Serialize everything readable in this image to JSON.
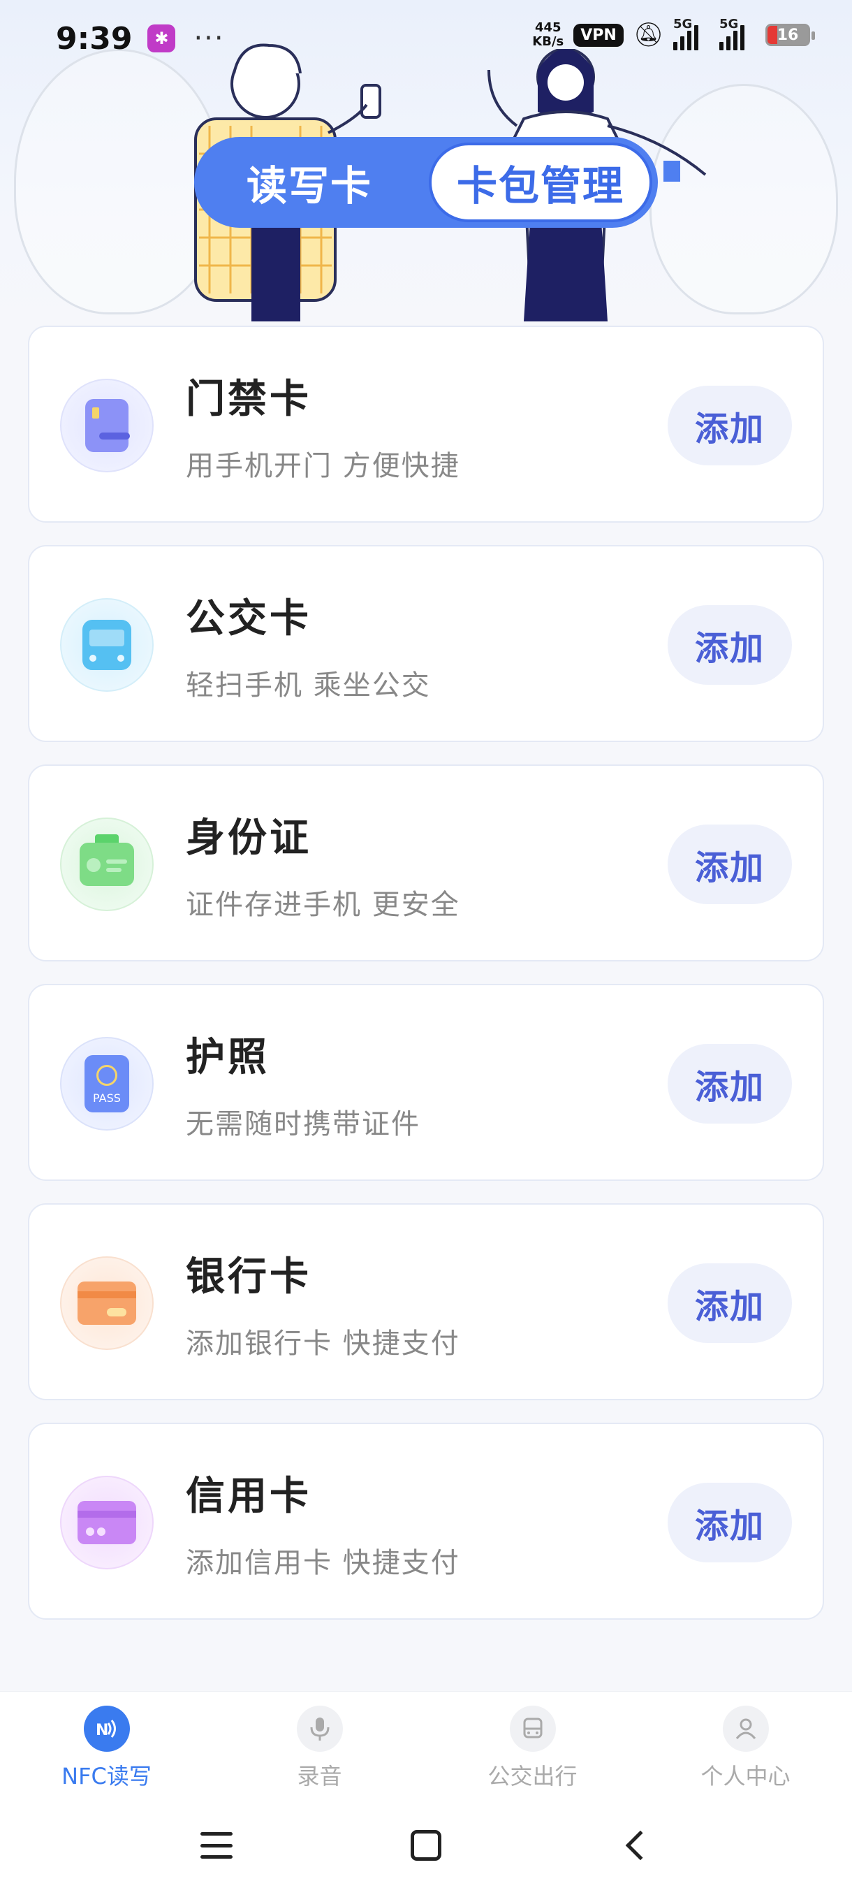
{
  "status_bar": {
    "time": "9:39",
    "more": "···",
    "speed_value": "445",
    "speed_unit": "KB/s",
    "vpn": "VPN",
    "signal_1": "5G",
    "signal_2": "5G",
    "battery": "16",
    "battery_level_percent": 16
  },
  "tabs": {
    "read_write": "读写卡",
    "wallet_manage": "卡包管理",
    "active": "wallet_manage"
  },
  "cards": [
    {
      "title": "门禁卡",
      "subtitle": "用手机开门 方便快捷",
      "button": "添加",
      "icon": "access-card-icon",
      "color": "#7b83f5"
    },
    {
      "title": "公交卡",
      "subtitle": "轻扫手机 乘坐公交",
      "button": "添加",
      "icon": "bus-icon",
      "color": "#49b8f0"
    },
    {
      "title": "身份证",
      "subtitle": "证件存进手机 更安全",
      "button": "添加",
      "icon": "id-card-icon",
      "color": "#5bd36b"
    },
    {
      "title": "护照",
      "subtitle": "无需随时携带证件",
      "button": "添加",
      "icon": "passport-icon",
      "color": "#5b7ef5",
      "icon_text": "PASS"
    },
    {
      "title": "银行卡",
      "subtitle": "添加银行卡 快捷支付",
      "button": "添加",
      "icon": "bank-card-icon",
      "color": "#f59a5b"
    },
    {
      "title": "信用卡",
      "subtitle": "添加信用卡 快捷支付",
      "button": "添加",
      "icon": "credit-card-icon",
      "color": "#c07bf5"
    }
  ],
  "bottom_nav": [
    {
      "label": "NFC读写",
      "icon": "nfc-icon",
      "active": true
    },
    {
      "label": "录音",
      "icon": "microphone-icon",
      "active": false
    },
    {
      "label": "公交出行",
      "icon": "bus-icon",
      "active": false
    },
    {
      "label": "个人中心",
      "icon": "user-icon",
      "active": false
    }
  ]
}
